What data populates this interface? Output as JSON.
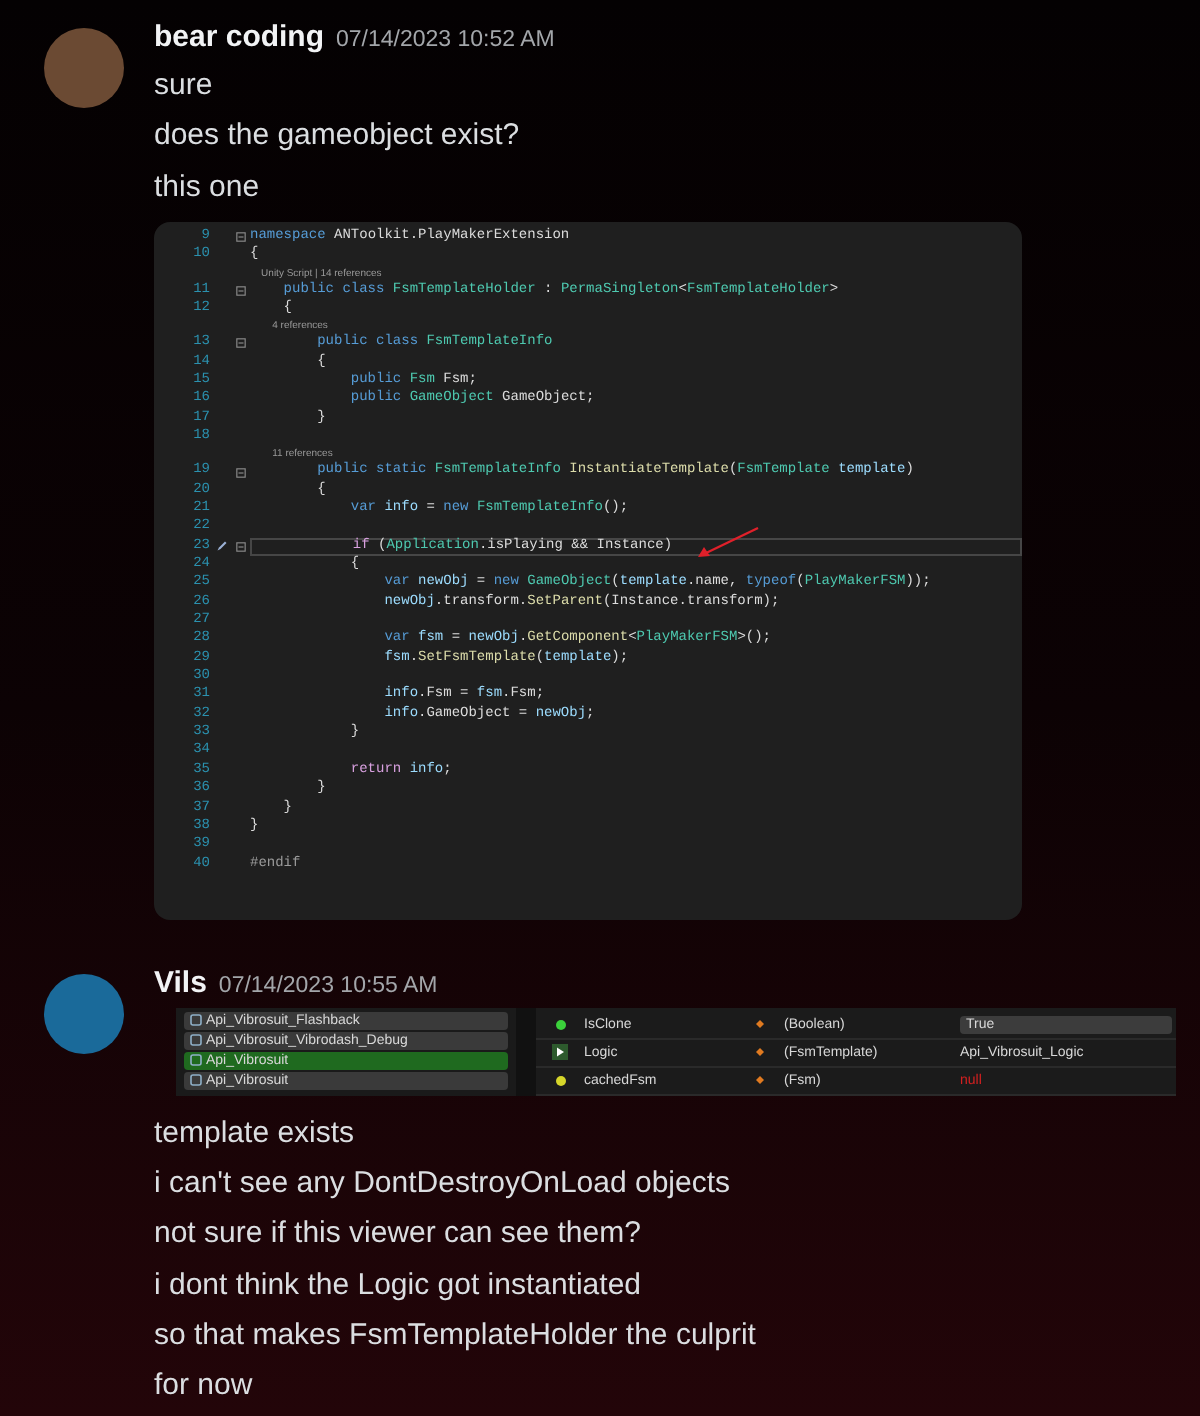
{
  "messages": [
    {
      "author": "bear coding",
      "timestamp": "07/14/2023 10:52 AM",
      "content": [
        {
          "kind": "text",
          "text": "sure"
        },
        {
          "kind": "text",
          "text": "does the gameobject exist?"
        },
        {
          "kind": "text",
          "text": "this one"
        },
        {
          "kind": "code",
          "lines": [
            {
              "kind": "code",
              "num": "9",
              "fold": true,
              "current": false,
              "tokens": [
                {
                  "t": "namespace",
                  "kind": "kw"
                },
                {
                  "t": " ANToolkit.PlayMakerExtension",
                  "kind": "plain"
                }
              ]
            },
            {
              "kind": "code",
              "num": "10",
              "fold": false,
              "current": false,
              "tokens": [
                {
                  "t": "{",
                  "kind": "plain"
                }
              ]
            },
            {
              "kind": "lens",
              "text": "    Unity Script | 14 references"
            },
            {
              "kind": "code",
              "num": "11",
              "fold": true,
              "current": false,
              "tokens": [
                {
                  "t": "    public class ",
                  "kind": "kw"
                },
                {
                  "t": "FsmTemplateHolder",
                  "kind": "type"
                },
                {
                  "t": " : ",
                  "kind": "plain"
                },
                {
                  "t": "PermaSingleton",
                  "kind": "type"
                },
                {
                  "t": "<",
                  "kind": "plain"
                },
                {
                  "t": "FsmTemplateHolder",
                  "kind": "type"
                },
                {
                  "t": ">",
                  "kind": "plain"
                }
              ]
            },
            {
              "kind": "code",
              "num": "12",
              "fold": false,
              "current": false,
              "tokens": [
                {
                  "t": "    {",
                  "kind": "plain"
                }
              ]
            },
            {
              "kind": "lens",
              "text": "        4 references"
            },
            {
              "kind": "code",
              "num": "13",
              "fold": true,
              "current": false,
              "tokens": [
                {
                  "t": "        public class ",
                  "kind": "kw"
                },
                {
                  "t": "FsmTemplateInfo",
                  "kind": "type"
                }
              ]
            },
            {
              "kind": "code",
              "num": "14",
              "fold": false,
              "current": false,
              "tokens": [
                {
                  "t": "        {",
                  "kind": "plain"
                }
              ]
            },
            {
              "kind": "code",
              "num": "15",
              "fold": false,
              "current": false,
              "tokens": [
                {
                  "t": "            public ",
                  "kind": "kw"
                },
                {
                  "t": "Fsm",
                  "kind": "type"
                },
                {
                  "t": " Fsm;",
                  "kind": "plain"
                }
              ]
            },
            {
              "kind": "code",
              "num": "16",
              "fold": false,
              "current": false,
              "tokens": [
                {
                  "t": "            public ",
                  "kind": "kw"
                },
                {
                  "t": "GameObject",
                  "kind": "type"
                },
                {
                  "t": " GameObject;",
                  "kind": "plain"
                }
              ]
            },
            {
              "kind": "code",
              "num": "17",
              "fold": false,
              "current": false,
              "tokens": [
                {
                  "t": "        }",
                  "kind": "plain"
                }
              ]
            },
            {
              "kind": "code",
              "num": "18",
              "fold": false,
              "current": false
            },
            {
              "kind": "lens",
              "text": "        11 references"
            },
            {
              "kind": "code",
              "num": "19",
              "fold": true,
              "current": false,
              "tokens": [
                {
                  "t": "        public static ",
                  "kind": "kw"
                },
                {
                  "t": "FsmTemplateInfo",
                  "kind": "type"
                },
                {
                  "t": " InstantiateTemplate",
                  "kind": "fn"
                },
                {
                  "t": "(",
                  "kind": "plain"
                },
                {
                  "t": "FsmTemplate",
                  "kind": "type"
                },
                {
                  "t": " template",
                  "kind": "var"
                },
                {
                  "t": ")",
                  "kind": "plain"
                }
              ]
            },
            {
              "kind": "code",
              "num": "20",
              "fold": false,
              "current": false,
              "tokens": [
                {
                  "t": "        {",
                  "kind": "plain"
                }
              ]
            },
            {
              "kind": "code",
              "num": "21",
              "fold": false,
              "current": false,
              "tokens": [
                {
                  "t": "            var ",
                  "kind": "kw"
                },
                {
                  "t": "info",
                  "kind": "var"
                },
                {
                  "t": " = ",
                  "kind": "plain"
                },
                {
                  "t": "new ",
                  "kind": "kw"
                },
                {
                  "t": "FsmTemplateInfo",
                  "kind": "type"
                },
                {
                  "t": "();",
                  "kind": "plain"
                }
              ]
            },
            {
              "kind": "code",
              "num": "22",
              "fold": false,
              "current": false
            },
            {
              "kind": "code",
              "num": "23",
              "fold": true,
              "current": true,
              "tokens": [
                {
                  "t": "            if",
                  "kind": "ctl"
                },
                {
                  "t": " (",
                  "kind": "plain"
                },
                {
                  "t": "Application",
                  "kind": "type"
                },
                {
                  "t": ".isPlaying && Instance)",
                  "kind": "plain"
                }
              ]
            },
            {
              "kind": "code",
              "num": "24",
              "fold": false,
              "current": false,
              "tokens": [
                {
                  "t": "            {",
                  "kind": "plain"
                }
              ]
            },
            {
              "kind": "code",
              "num": "25",
              "fold": false,
              "current": false,
              "tokens": [
                {
                  "t": "                var ",
                  "kind": "kw"
                },
                {
                  "t": "newObj",
                  "kind": "var"
                },
                {
                  "t": " = ",
                  "kind": "plain"
                },
                {
                  "t": "new ",
                  "kind": "kw"
                },
                {
                  "t": "GameObject",
                  "kind": "type"
                },
                {
                  "t": "(",
                  "kind": "plain"
                },
                {
                  "t": "template",
                  "kind": "var"
                },
                {
                  "t": ".name, ",
                  "kind": "plain"
                },
                {
                  "t": "typeof",
                  "kind": "kw"
                },
                {
                  "t": "(",
                  "kind": "plain"
                },
                {
                  "t": "PlayMakerFSM",
                  "kind": "type"
                },
                {
                  "t": "));",
                  "kind": "plain"
                }
              ]
            },
            {
              "kind": "code",
              "num": "26",
              "fold": false,
              "current": false,
              "tokens": [
                {
                  "t": "                newObj",
                  "kind": "var"
                },
                {
                  "t": ".transform.",
                  "kind": "plain"
                },
                {
                  "t": "SetParent",
                  "kind": "fn"
                },
                {
                  "t": "(Instance.transform);",
                  "kind": "plain"
                }
              ]
            },
            {
              "kind": "code",
              "num": "27",
              "fold": false,
              "current": false
            },
            {
              "kind": "code",
              "num": "28",
              "fold": false,
              "current": false,
              "tokens": [
                {
                  "t": "                var ",
                  "kind": "kw"
                },
                {
                  "t": "fsm",
                  "kind": "var"
                },
                {
                  "t": " = ",
                  "kind": "plain"
                },
                {
                  "t": "newObj",
                  "kind": "var"
                },
                {
                  "t": ".",
                  "kind": "plain"
                },
                {
                  "t": "GetComponent",
                  "kind": "fn"
                },
                {
                  "t": "<",
                  "kind": "plain"
                },
                {
                  "t": "PlayMakerFSM",
                  "kind": "type"
                },
                {
                  "t": ">();",
                  "kind": "plain"
                }
              ]
            },
            {
              "kind": "code",
              "num": "29",
              "fold": false,
              "current": false,
              "tokens": [
                {
                  "t": "                fsm",
                  "kind": "var"
                },
                {
                  "t": ".",
                  "kind": "plain"
                },
                {
                  "t": "SetFsmTemplate",
                  "kind": "fn"
                },
                {
                  "t": "(",
                  "kind": "plain"
                },
                {
                  "t": "template",
                  "kind": "var"
                },
                {
                  "t": ");",
                  "kind": "plain"
                }
              ]
            },
            {
              "kind": "code",
              "num": "30",
              "fold": false,
              "current": false
            },
            {
              "kind": "code",
              "num": "31",
              "fold": false,
              "current": false,
              "tokens": [
                {
                  "t": "                info",
                  "kind": "var"
                },
                {
                  "t": ".Fsm = ",
                  "kind": "plain"
                },
                {
                  "t": "fsm",
                  "kind": "var"
                },
                {
                  "t": ".Fsm;",
                  "kind": "plain"
                }
              ]
            },
            {
              "kind": "code",
              "num": "32",
              "fold": false,
              "current": false,
              "tokens": [
                {
                  "t": "                info",
                  "kind": "var"
                },
                {
                  "t": ".GameObject = ",
                  "kind": "plain"
                },
                {
                  "t": "newObj",
                  "kind": "var"
                },
                {
                  "t": ";",
                  "kind": "plain"
                }
              ]
            },
            {
              "kind": "code",
              "num": "33",
              "fold": false,
              "current": false,
              "tokens": [
                {
                  "t": "            }",
                  "kind": "plain"
                }
              ]
            },
            {
              "kind": "code",
              "num": "34",
              "fold": false,
              "current": false
            },
            {
              "kind": "code",
              "num": "35",
              "fold": false,
              "current": false,
              "tokens": [
                {
                  "t": "            return ",
                  "kind": "ctl"
                },
                {
                  "t": "info",
                  "kind": "var"
                },
                {
                  "t": ";",
                  "kind": "plain"
                }
              ]
            },
            {
              "kind": "code",
              "num": "36",
              "fold": false,
              "current": false,
              "tokens": [
                {
                  "t": "        }",
                  "kind": "plain"
                }
              ]
            },
            {
              "kind": "code",
              "num": "37",
              "fold": false,
              "current": false,
              "tokens": [
                {
                  "t": "    }",
                  "kind": "plain"
                }
              ]
            },
            {
              "kind": "code",
              "num": "38",
              "fold": false,
              "current": false,
              "tokens": [
                {
                  "t": "}",
                  "kind": "plain"
                }
              ]
            },
            {
              "kind": "code",
              "num": "39",
              "fold": false,
              "current": false
            },
            {
              "kind": "code",
              "num": "40",
              "fold": false,
              "current": false,
              "tokens": [
                {
                  "t": "#endif",
                  "kind": "pre"
                }
              ]
            }
          ]
        }
      ]
    },
    {
      "author": "Vils",
      "timestamp": "07/14/2023 10:55 AM",
      "content": [
        {
          "kind": "inspector",
          "objects": [
            {
              "label": "Api_Vibrosuit_Flashback",
              "selected": false
            },
            {
              "label": "Api_Vibrosuit_Vibrodash_Debug",
              "selected": false
            },
            {
              "label": "Api_Vibrosuit",
              "selected": true
            },
            {
              "label": "Api_Vibrosuit",
              "selected": false
            }
          ],
          "fields": [
            {
              "kind": "bool",
              "name": "IsClone",
              "type": "(Boolean)",
              "value": {
                "kind": "box",
                "text": "True"
              }
            },
            {
              "kind": "template",
              "name": "Logic",
              "type": "(FsmTemplate)",
              "value": {
                "kind": "text",
                "text": "Api_Vibrosuit_Logic"
              }
            },
            {
              "kind": "fsm",
              "name": "cachedFsm",
              "type": "(Fsm)",
              "value": {
                "kind": "null",
                "text": "null"
              }
            }
          ]
        },
        {
          "kind": "text",
          "text": "template exists"
        },
        {
          "kind": "text",
          "text": "i can't see any DontDestroyOnLoad objects"
        },
        {
          "kind": "text",
          "text": "not sure if this viewer can see them?"
        },
        {
          "kind": "text",
          "text": "i dont think the Logic got instantiated"
        },
        {
          "kind": "text",
          "text": "so that makes FsmTemplateHolder the culprit"
        },
        {
          "kind": "text",
          "text": "for now"
        }
      ]
    }
  ]
}
